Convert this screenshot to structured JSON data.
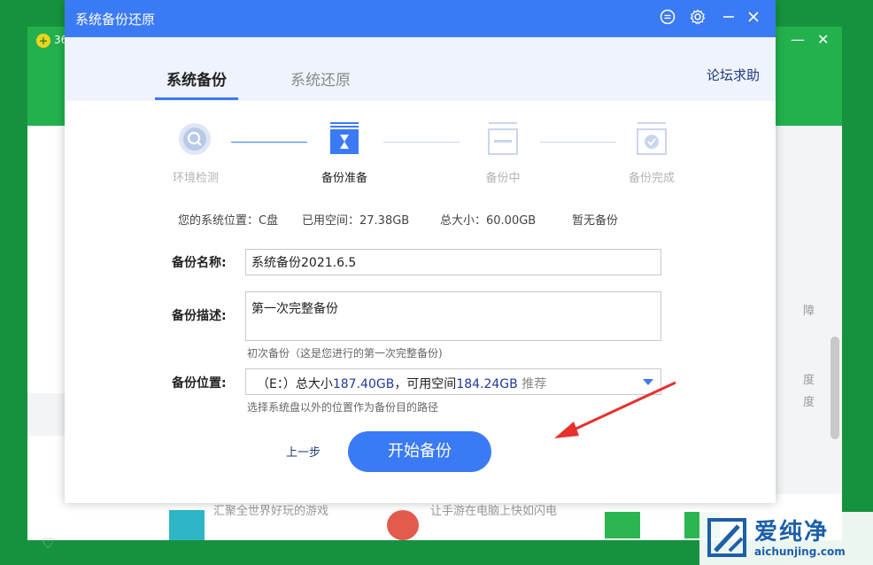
{
  "background_app": {
    "name_fragment": "36",
    "close_char": "✕",
    "min_char": "—",
    "right_edge_chars": [
      "障",
      "度",
      "度"
    ],
    "promo_texts": [
      "汇聚全世界好玩的游戏",
      "让手游在电脑上快如闪电"
    ]
  },
  "dialog": {
    "title": "系统备份还原",
    "tabs": [
      {
        "label": "系统备份",
        "active": true
      },
      {
        "label": "系统还原",
        "active": false
      }
    ],
    "forum_help": "论坛求助",
    "steps": [
      {
        "label": "环境检测",
        "state": "done",
        "icon": "search-icon"
      },
      {
        "label": "备份准备",
        "state": "active",
        "icon": "hourglass-icon"
      },
      {
        "label": "备份中",
        "state": "pending",
        "icon": "progress-icon"
      },
      {
        "label": "备份完成",
        "state": "pending",
        "icon": "check-icon"
      }
    ],
    "info": {
      "system_location": "您的系统位置：C盘",
      "used_space": "已用空间：27.38GB",
      "total_size": "总大小：60.00GB",
      "no_backup": "暂无备份"
    },
    "form": {
      "name_label": "备份名称:",
      "name_value": "系统备份2021.6.5",
      "desc_label": "备份描述:",
      "desc_value": "第一次完整备份",
      "desc_hint": "初次备份（这是您进行的第一次完整备份)",
      "location_label": "备份位置:",
      "location": {
        "drive": "（E：）总大小",
        "total": "187.40GB",
        "available_prefix": "，可用空间",
        "available": "184.24GB",
        "tag": " 推荐"
      },
      "location_hint": "选择系统盘以外的位置作为备份目的路径"
    },
    "buttons": {
      "prev": "上一步",
      "start": "开始备份"
    }
  },
  "watermark": {
    "title": "爱纯净",
    "url": "aichunjing.com"
  },
  "colors": {
    "accent": "#3b7af5",
    "bg_green": "#16923f",
    "header_green": "#23b14d",
    "arrow_red": "#e6312d"
  }
}
